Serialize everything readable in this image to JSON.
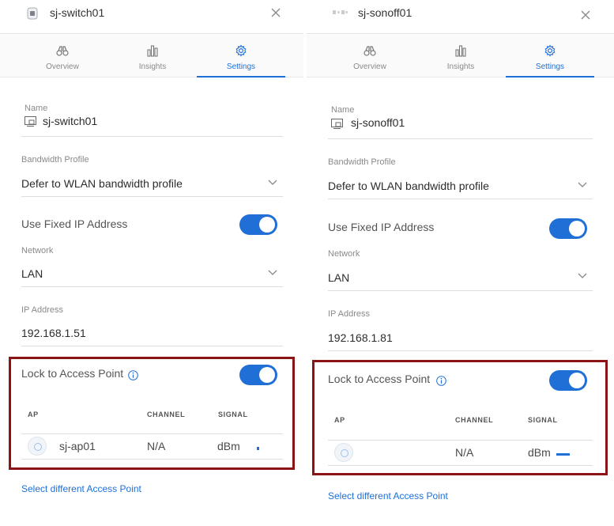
{
  "panels": [
    {
      "device_title": "sj-switch01",
      "tabs": [
        {
          "label": "Overview",
          "icon": "binoculars-icon"
        },
        {
          "label": "Insights",
          "icon": "bar-chart-icon"
        },
        {
          "label": "Settings",
          "icon": "gear-icon"
        }
      ],
      "active_tab": "Settings",
      "name_label": "Name",
      "name_value": "sj-switch01",
      "bandwidth_label": "Bandwidth Profile",
      "bandwidth_value": "Defer to WLAN bandwidth profile",
      "fixed_ip_label": "Use Fixed IP Address",
      "fixed_ip_on": true,
      "network_label": "Network",
      "network_value": "LAN",
      "ip_label": "IP Address",
      "ip_value": "192.168.1.51",
      "lock_label": "Lock to Access Point",
      "lock_on": true,
      "table_headers": {
        "ap": "AP",
        "channel": "CHANNEL",
        "signal": "SIGNAL"
      },
      "row": {
        "ap": "sj-ap01",
        "channel": "N/A",
        "signal": "dBm"
      },
      "link_label": "Select different Access Point"
    },
    {
      "device_title": "sj-sonoff01",
      "tabs": [
        {
          "label": "Overview",
          "icon": "binoculars-icon"
        },
        {
          "label": "Insights",
          "icon": "bar-chart-icon"
        },
        {
          "label": "Settings",
          "icon": "gear-icon"
        }
      ],
      "active_tab": "Settings",
      "name_label": "Name",
      "name_value": "sj-sonoff01",
      "bandwidth_label": "Bandwidth Profile",
      "bandwidth_value": "Defer to WLAN bandwidth profile",
      "fixed_ip_label": "Use Fixed IP Address",
      "fixed_ip_on": true,
      "network_label": "Network",
      "network_value": "LAN",
      "ip_label": "IP Address",
      "ip_value": "192.168.1.81",
      "lock_label": "Lock to Access Point",
      "lock_on": true,
      "table_headers": {
        "ap": "AP",
        "channel": "CHANNEL",
        "signal": "SIGNAL"
      },
      "row": {
        "ap": "",
        "channel": "N/A",
        "signal": "dBm"
      },
      "link_label": "Select different Access Point"
    }
  ],
  "colors": {
    "accent": "#1f6fd6",
    "highlight_border": "#8b1414"
  }
}
